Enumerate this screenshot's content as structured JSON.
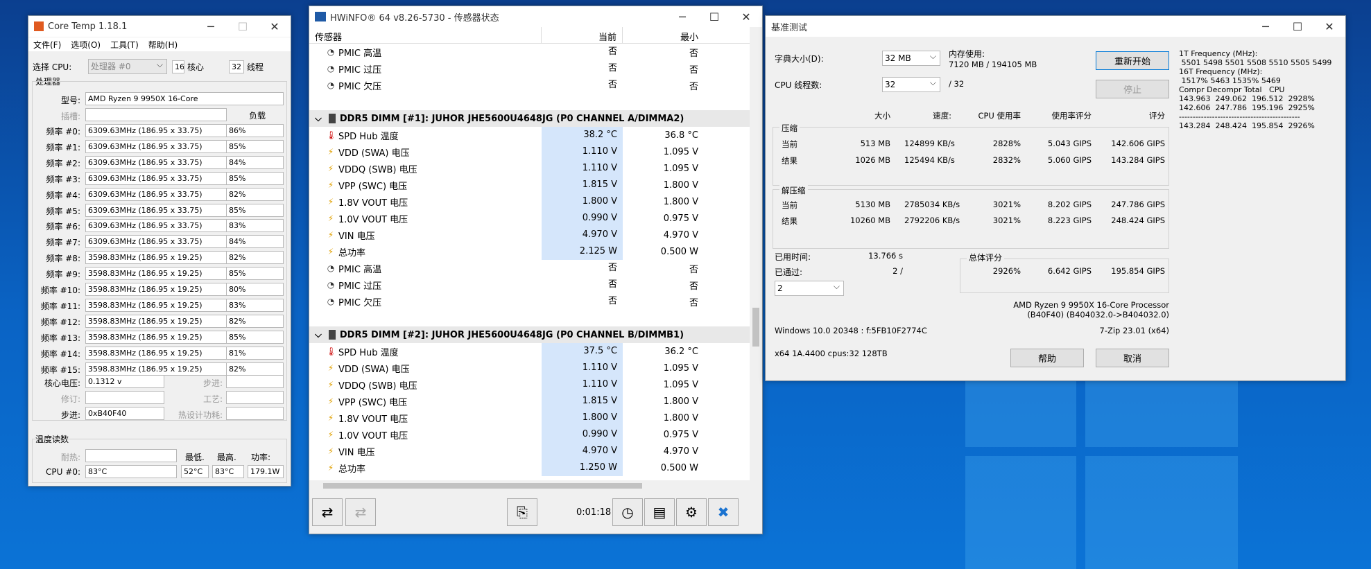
{
  "coretemp": {
    "title": "Core Temp 1.18.1",
    "menu": [
      "文件(F)",
      "选项(O)",
      "工具(T)",
      "帮助(H)"
    ],
    "select_cpu_label": "选择 CPU:",
    "select_cpu_value": "处理器 #0",
    "cores_value": "16",
    "cores_label": "核心",
    "threads_value": "32",
    "threads_label": "线程",
    "processor_group": "处理器",
    "model_label": "型号:",
    "model_value": "AMD Ryzen 9 9950X 16-Core",
    "socket_label": "插槽:",
    "load_header": "负载",
    "freq_rows": [
      {
        "label": "频率 #0:",
        "freq": "6309.63MHz (186.95 x 33.75)",
        "load": "86%"
      },
      {
        "label": "频率 #1:",
        "freq": "6309.63MHz (186.95 x 33.75)",
        "load": "85%"
      },
      {
        "label": "频率 #2:",
        "freq": "6309.63MHz (186.95 x 33.75)",
        "load": "84%"
      },
      {
        "label": "频率 #3:",
        "freq": "6309.63MHz (186.95 x 33.75)",
        "load": "85%"
      },
      {
        "label": "频率 #4:",
        "freq": "6309.63MHz (186.95 x 33.75)",
        "load": "82%"
      },
      {
        "label": "频率 #5:",
        "freq": "6309.63MHz (186.95 x 33.75)",
        "load": "85%"
      },
      {
        "label": "频率 #6:",
        "freq": "6309.63MHz (186.95 x 33.75)",
        "load": "83%"
      },
      {
        "label": "频率 #7:",
        "freq": "6309.63MHz (186.95 x 33.75)",
        "load": "84%"
      },
      {
        "label": "频率 #8:",
        "freq": "3598.83MHz (186.95 x 19.25)",
        "load": "82%"
      },
      {
        "label": "频率 #9:",
        "freq": "3598.83MHz (186.95 x 19.25)",
        "load": "85%"
      },
      {
        "label": "频率 #10:",
        "freq": "3598.83MHz (186.95 x 19.25)",
        "load": "80%"
      },
      {
        "label": "频率 #11:",
        "freq": "3598.83MHz (186.95 x 19.25)",
        "load": "83%"
      },
      {
        "label": "频率 #12:",
        "freq": "3598.83MHz (186.95 x 19.25)",
        "load": "82%"
      },
      {
        "label": "频率 #13:",
        "freq": "3598.83MHz (186.95 x 19.25)",
        "load": "85%"
      },
      {
        "label": "频率 #14:",
        "freq": "3598.83MHz (186.95 x 19.25)",
        "load": "81%"
      },
      {
        "label": "频率 #15:",
        "freq": "3598.83MHz (186.95 x 19.25)",
        "load": "82%"
      }
    ],
    "vid_label": "核心电压:",
    "vid_value": "0.1312 v",
    "stepping_label": "步进:",
    "revision_label": "修订:",
    "lithography_label": "工艺:",
    "cpuid_label": "步进:",
    "cpuid_value": "0xB40F40",
    "tdp_label": "热设计功耗:",
    "temp_group": "温度读数",
    "tj_label": "耐热:",
    "min_header": "最低.",
    "max_header": "最高.",
    "power_header": "功率:",
    "cpu0_label": "CPU #0:",
    "cpu0_temp": "83°C",
    "cpu0_min": "52°C",
    "cpu0_max": "83°C",
    "cpu0_power": "179.1W"
  },
  "hwinfo": {
    "title": "HWiNFO® 64 v8.26-5730 - 传感器状态",
    "col_sensor": "传感器",
    "col_current": "当前",
    "col_min": "最小",
    "rows_top": [
      {
        "icon": "clock",
        "name": "PMIC 高温",
        "cur": "否",
        "min": "否"
      },
      {
        "icon": "clock",
        "name": "PMIC 过压",
        "cur": "否",
        "min": "否"
      },
      {
        "icon": "clock",
        "name": "PMIC 欠压",
        "cur": "否",
        "min": "否"
      }
    ],
    "group1": "DDR5 DIMM [#1]: JUHOR JHE5600U4648JG (P0 CHANNEL A/DIMMA2)",
    "rows_g1": [
      {
        "icon": "temp",
        "name": "SPD Hub 温度",
        "cur": "38.2 °C",
        "min": "36.8 °C"
      },
      {
        "icon": "volt",
        "name": "VDD (SWA) 电压",
        "cur": "1.110 V",
        "min": "1.095 V"
      },
      {
        "icon": "volt",
        "name": "VDDQ (SWB) 电压",
        "cur": "1.110 V",
        "min": "1.095 V"
      },
      {
        "icon": "volt",
        "name": "VPP (SWC) 电压",
        "cur": "1.815 V",
        "min": "1.800 V"
      },
      {
        "icon": "volt",
        "name": "1.8V VOUT 电压",
        "cur": "1.800 V",
        "min": "1.800 V"
      },
      {
        "icon": "volt",
        "name": "1.0V VOUT 电压",
        "cur": "0.990 V",
        "min": "0.975 V"
      },
      {
        "icon": "volt",
        "name": "VIN 电压",
        "cur": "4.970 V",
        "min": "4.970 V"
      },
      {
        "icon": "volt",
        "name": "总功率",
        "cur": "2.125 W",
        "min": "0.500 W"
      },
      {
        "icon": "clock",
        "name": "PMIC 高温",
        "cur": "否",
        "min": "否"
      },
      {
        "icon": "clock",
        "name": "PMIC 过压",
        "cur": "否",
        "min": "否"
      },
      {
        "icon": "clock",
        "name": "PMIC 欠压",
        "cur": "否",
        "min": "否"
      }
    ],
    "group2": "DDR5 DIMM [#2]: JUHOR JHE5600U4648JG (P0 CHANNEL B/DIMMB1)",
    "rows_g2": [
      {
        "icon": "temp",
        "name": "SPD Hub 温度",
        "cur": "37.5 °C",
        "min": "36.2 °C"
      },
      {
        "icon": "volt",
        "name": "VDD (SWA) 电压",
        "cur": "1.110 V",
        "min": "1.095 V"
      },
      {
        "icon": "volt",
        "name": "VDDQ (SWB) 电压",
        "cur": "1.110 V",
        "min": "1.095 V"
      },
      {
        "icon": "volt",
        "name": "VPP (SWC) 电压",
        "cur": "1.815 V",
        "min": "1.800 V"
      },
      {
        "icon": "volt",
        "name": "1.8V VOUT 电压",
        "cur": "1.800 V",
        "min": "1.800 V"
      },
      {
        "icon": "volt",
        "name": "1.0V VOUT 电压",
        "cur": "0.990 V",
        "min": "0.975 V"
      },
      {
        "icon": "volt",
        "name": "VIN 电压",
        "cur": "4.970 V",
        "min": "4.970 V"
      },
      {
        "icon": "volt",
        "name": "总功率",
        "cur": "1.250 W",
        "min": "0.500 W"
      }
    ],
    "timer": "0:01:18"
  },
  "sevenzip": {
    "title": "基准测试",
    "dict_label": "字典大小(D):",
    "dict_value": "32 MB",
    "mem_label": "内存使用:",
    "mem_value": "7120 MB / 194105 MB",
    "restart_button": "重新开始",
    "threads_label": "CPU 线程数:",
    "threads_value": "32",
    "threads_total": "/ 32",
    "stop_button": "停止",
    "col_size": "大小",
    "col_speed": "速度:",
    "col_cpu_usage": "CPU 使用率",
    "col_usage_rating": "使用率评分",
    "col_rating": "评分",
    "compress_group": "压缩",
    "decompress_group": "解压缩",
    "current_label": "当前",
    "result_label": "结果",
    "comp_current": [
      "513 MB",
      "124899 KB/s",
      "2828%",
      "5.043 GIPS",
      "142.606 GIPS"
    ],
    "comp_result": [
      "1026 MB",
      "125494 KB/s",
      "2832%",
      "5.060 GIPS",
      "143.284 GIPS"
    ],
    "decomp_current": [
      "5130 MB",
      "2785034 KB/s",
      "3021%",
      "8.202 GIPS",
      "247.786 GIPS"
    ],
    "decomp_result": [
      "10260 MB",
      "2792206 KB/s",
      "3021%",
      "8.223 GIPS",
      "248.424 GIPS"
    ],
    "elapsed_label": "已用时间:",
    "elapsed_value": "13.766 s",
    "passed_label": "已通过:",
    "passed_value": "2 /",
    "passes_select": "2",
    "total_group": "总体评分",
    "total_values": [
      "2926%",
      "6.642 GIPS",
      "195.854 GIPS"
    ],
    "cpu_name": "AMD Ryzen 9 9950X 16-Core Processor",
    "cpu_id": "(B40F40) (B404032.0->B404032.0)",
    "os_info": "Windows 10.0 20348 : f:5FB10F2774C",
    "version": "7-Zip 23.01 (x64)",
    "arch_info": "x64 1A.4400 cpus:32 128TB",
    "help_button": "帮助",
    "cancel_button": "取消",
    "side_lines": [
      "1T Frequency (MHz):",
      " 5501 5498 5501 5508 5510 5505 5499",
      "16T Frequency (MHz):",
      " 1517% 5463 1535% 5469",
      "Compr Decompr Total   CPU",
      "143.963  249.062  196.512  2928%",
      "142.606  247.786  195.196  2925%",
      "--------------------------------------------",
      "143.284  248.424  195.854  2926%"
    ]
  },
  "colors": {
    "accent": "#0078d7",
    "highlight": "#d5e6fb",
    "desktop": "#0a63c4"
  }
}
